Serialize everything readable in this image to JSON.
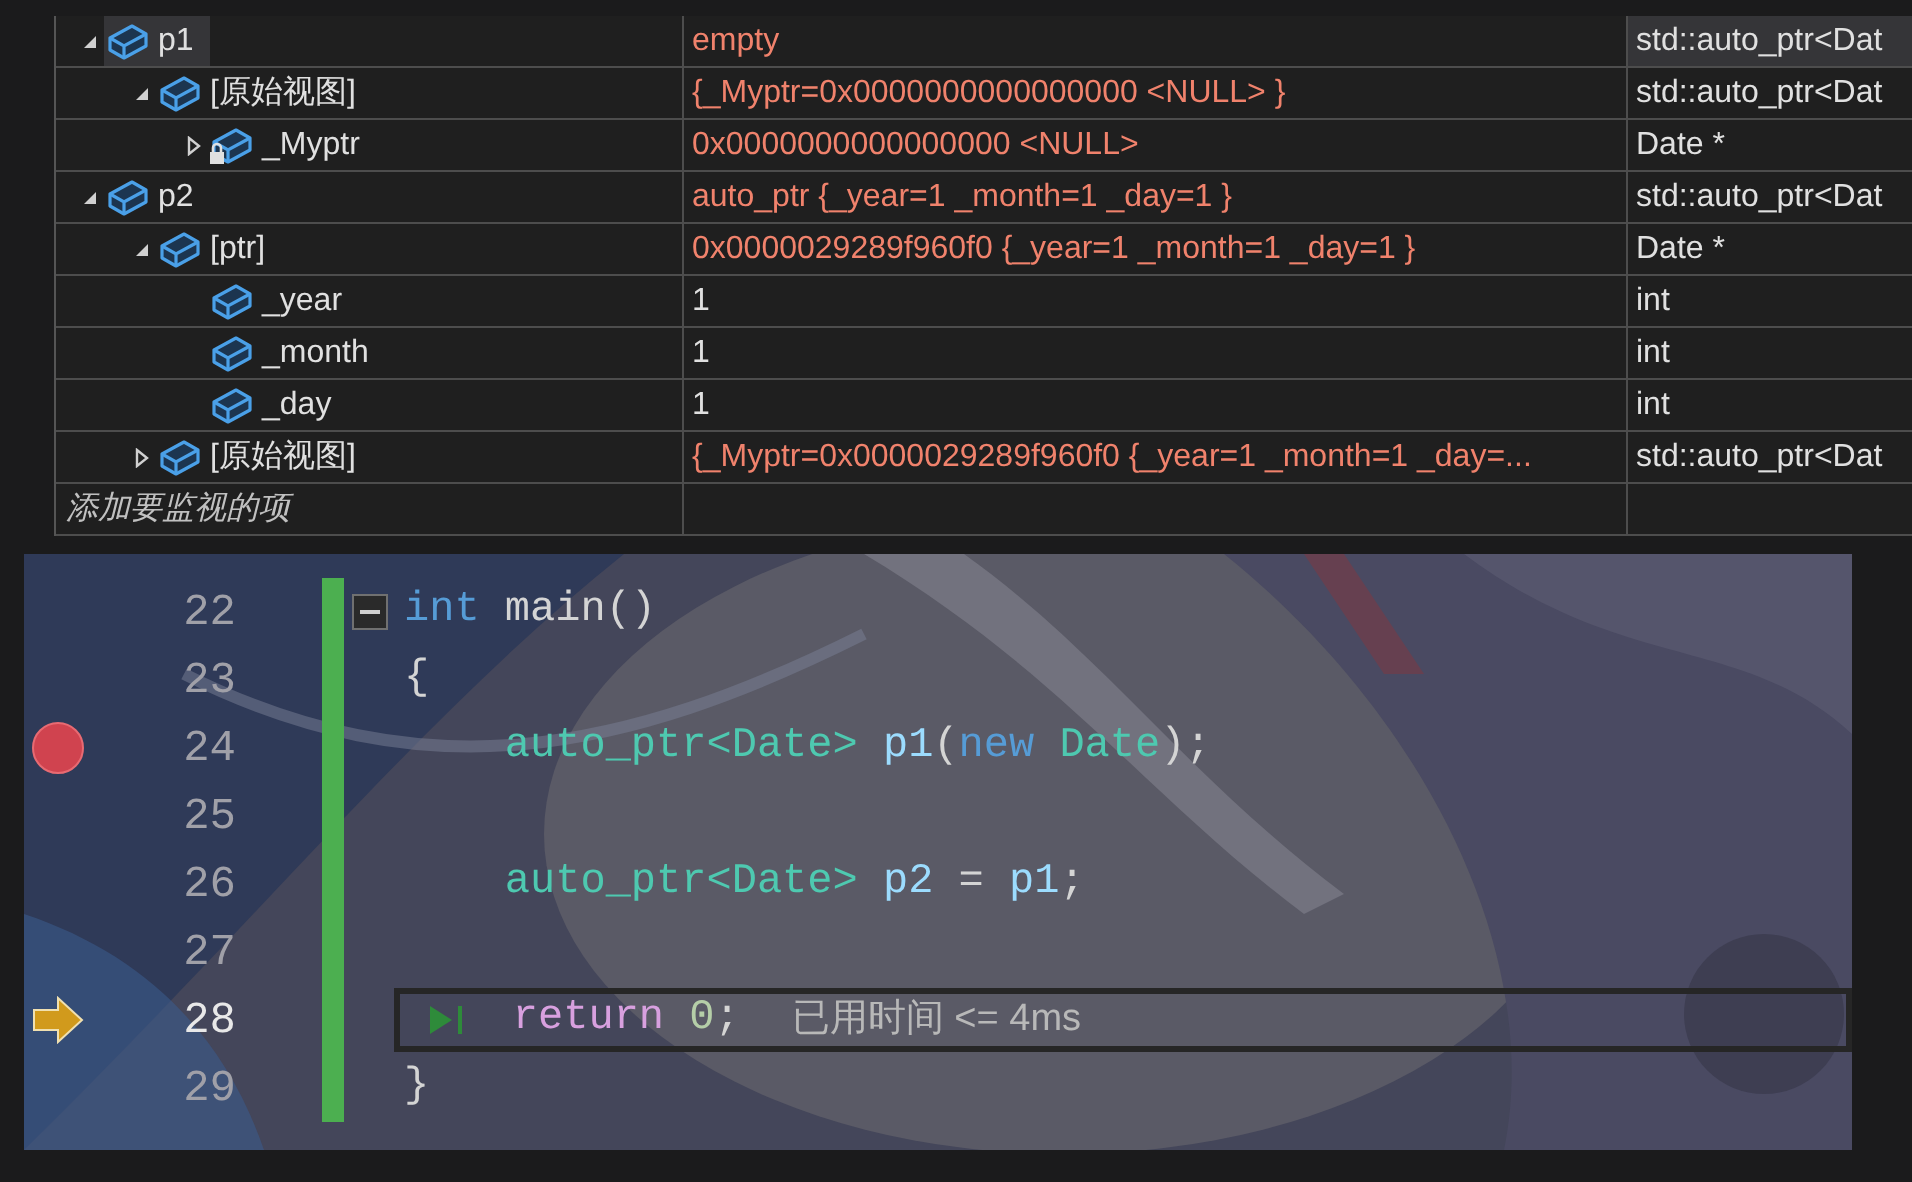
{
  "watch": {
    "rows": [
      {
        "name": "p1",
        "value": "empty",
        "type": "std::auto_ptr<Dat",
        "expanded": true,
        "selected": true,
        "locked": false,
        "children": [
          {
            "name": "[原始视图]",
            "value": "{_Myptr=0x0000000000000000 <NULL> }",
            "type": "std::auto_ptr<Dat",
            "expanded": true,
            "selected": false,
            "locked": false,
            "children": [
              {
                "name": "_Myptr",
                "value": "0x0000000000000000 <NULL>",
                "type": "Date *",
                "expanded": false,
                "selected": false,
                "locked": true
              }
            ]
          }
        ]
      },
      {
        "name": "p2",
        "value": "auto_ptr {_year=1 _month=1 _day=1 }",
        "type": "std::auto_ptr<Dat",
        "expanded": true,
        "selected": false,
        "locked": false,
        "children": [
          {
            "name": "[ptr]",
            "value": "0x0000029289f960f0 {_year=1 _month=1 _day=1 }",
            "type": "Date *",
            "expanded": true,
            "selected": false,
            "locked": false,
            "children": [
              {
                "name": "_year",
                "value": "1",
                "type": "int",
                "selected": false,
                "locked": false
              },
              {
                "name": "_month",
                "value": "1",
                "type": "int",
                "selected": false,
                "locked": false
              },
              {
                "name": "_day",
                "value": "1",
                "type": "int",
                "selected": false,
                "locked": false
              }
            ]
          },
          {
            "name": "[原始视图]",
            "value": "{_Myptr=0x0000029289f960f0 {_year=1 _month=1 _day=...",
            "type": "std::auto_ptr<Dat",
            "expanded": false,
            "selected": false,
            "locked": false
          }
        ]
      }
    ],
    "add_placeholder": "添加要监视的项"
  },
  "editor": {
    "lines": [
      {
        "number": "22",
        "fold": true,
        "breakpoint": false,
        "current": false,
        "tokens": [
          {
            "text": "int",
            "kind": "keyword"
          },
          {
            "text": " main()",
            "kind": "plain"
          }
        ]
      },
      {
        "number": "23",
        "fold": false,
        "breakpoint": false,
        "current": false,
        "tokens": [
          {
            "text": "{",
            "kind": "plain"
          }
        ]
      },
      {
        "number": "24",
        "fold": false,
        "breakpoint": true,
        "current": false,
        "tokens": [
          {
            "text": "    auto_ptr<Date>",
            "kind": "type"
          },
          {
            "text": " p1",
            "kind": "ident"
          },
          {
            "text": "(",
            "kind": "plain"
          },
          {
            "text": "new",
            "kind": "keyword"
          },
          {
            "text": " Date",
            "kind": "type"
          },
          {
            "text": ");",
            "kind": "plain"
          }
        ]
      },
      {
        "number": "25",
        "fold": false,
        "breakpoint": false,
        "current": false
      },
      {
        "number": "26",
        "fold": false,
        "breakpoint": false,
        "current": false,
        "tokens": [
          {
            "text": "    auto_ptr<Date>",
            "kind": "type"
          },
          {
            "text": " p2",
            "kind": "ident"
          },
          {
            "text": " = ",
            "kind": "plain"
          },
          {
            "text": "p1",
            "kind": "ident"
          },
          {
            "text": ";",
            "kind": "plain"
          }
        ]
      },
      {
        "number": "27",
        "fold": false,
        "breakpoint": false,
        "current": false
      },
      {
        "number": "28",
        "fold": false,
        "breakpoint": false,
        "current": true,
        "hint": "已用时间 <= 4ms",
        "tokens": [
          {
            "text": "    return",
            "kind": "control"
          },
          {
            "text": " 0",
            "kind": "number"
          },
          {
            "text": ";",
            "kind": "plain"
          }
        ]
      },
      {
        "number": "29",
        "fold": false,
        "breakpoint": false,
        "current": false,
        "tokens": [
          {
            "text": "}",
            "kind": "plain"
          }
        ]
      }
    ]
  }
}
